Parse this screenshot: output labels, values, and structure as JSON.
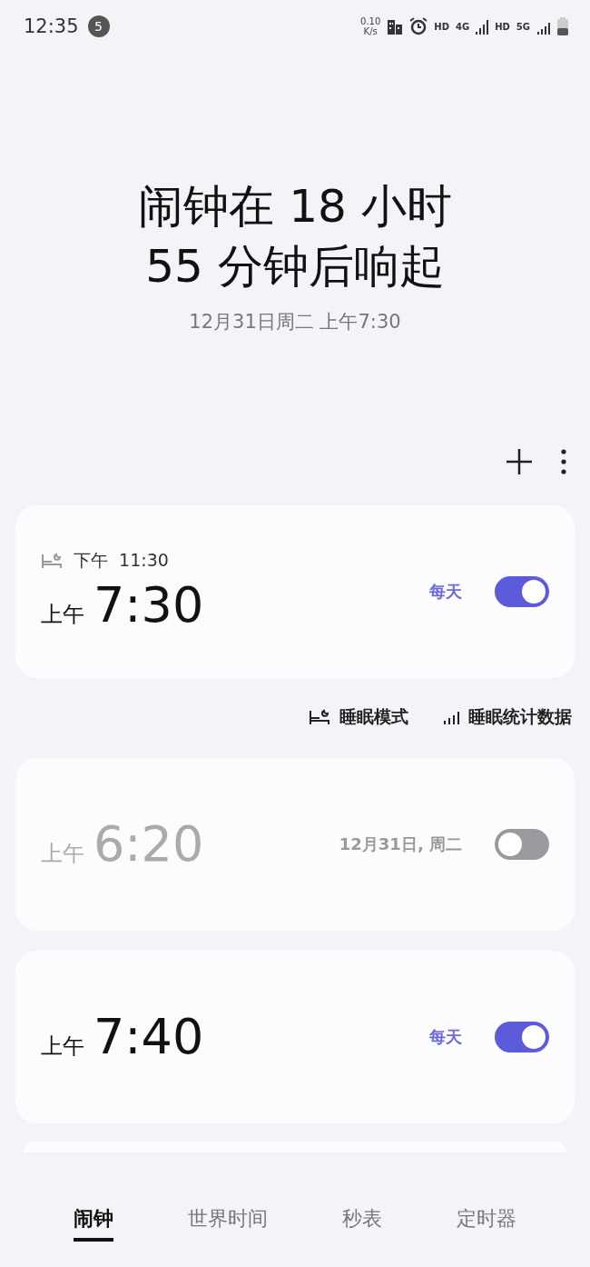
{
  "status_bar": {
    "time": "12:35",
    "notification_count": "5",
    "net_speed": "0.10",
    "net_unit": "K/s",
    "hd_1": "HD",
    "net_1": "4G",
    "hd_2": "HD",
    "net_2": "5G"
  },
  "header": {
    "headline": "闹钟在 18 小时 55 分钟后响起",
    "next_alarm": "12月31日周二 上午7:30"
  },
  "alarms": [
    {
      "bedtime": {
        "period": "下午",
        "time": "11:30"
      },
      "period": "上午",
      "time": "7:30",
      "repeat": "每天",
      "on": true
    },
    {
      "period": "上午",
      "time": "6:20",
      "repeat": "12月31日, 周二",
      "on": false
    },
    {
      "period": "上午",
      "time": "7:40",
      "repeat": "每天",
      "on": true
    }
  ],
  "sleep_links": [
    {
      "kind": "mode",
      "label": "睡眠模式"
    },
    {
      "kind": "stats",
      "label": "睡眠统计数据"
    }
  ],
  "tabs": [
    {
      "label": "闹钟",
      "selected": true
    },
    {
      "label": "世界时间",
      "selected": false
    },
    {
      "label": "秒表",
      "selected": false
    },
    {
      "label": "定时器",
      "selected": false
    }
  ]
}
